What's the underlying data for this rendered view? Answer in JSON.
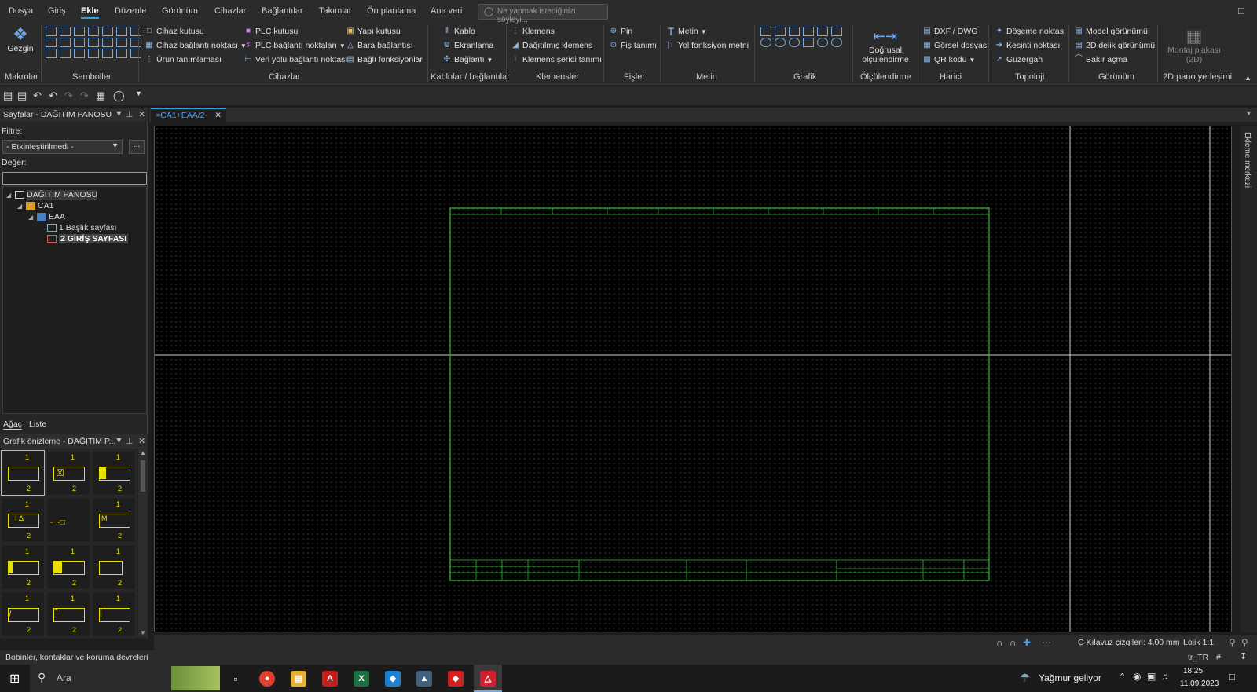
{
  "menu": {
    "items": [
      "Dosya",
      "Giriş",
      "Ekle",
      "Düzenle",
      "Görünüm",
      "Cihazlar",
      "Bağlantılar",
      "Takımlar",
      "Ön planlama",
      "Ana veri"
    ],
    "active": "Ekle",
    "search_placeholder": "Ne yapmak istediğinizi söyleyi..."
  },
  "ribbon": {
    "makrolar": {
      "label": "Makrolar",
      "gezgin": "Gezgin"
    },
    "semboller": {
      "label": "Semboller"
    },
    "cihazlar": {
      "label": "Cihazlar",
      "items": [
        "Cihaz kutusu",
        "Cihaz bağlantı noktası",
        "Ürün tanımlaması",
        "PLC kutusu",
        "PLC bağlantı noktaları",
        "Veri yolu bağlantı noktası",
        "Yapı kutusu",
        "Bara bağlantısı",
        "Bağlı fonksiyonlar"
      ]
    },
    "kablolar": {
      "label": "Kablolar / bağlantılar",
      "items": [
        "Kablo",
        "Ekranlama",
        "Bağlantı"
      ]
    },
    "klemensler": {
      "label": "Klemensler",
      "items": [
        "Klemens",
        "Dağıtılmış klemens",
        "Klemens şeridi tanımı"
      ]
    },
    "fisler": {
      "label": "Fişler",
      "items": [
        "Pin",
        "Fiş tanımı"
      ]
    },
    "metin": {
      "label": "Metin",
      "items": [
        "Metin",
        "Yol fonksiyon metni"
      ]
    },
    "grafik": {
      "label": "Grafik"
    },
    "olculendirme": {
      "label": "Ölçülendirme",
      "button": "Doğrusal ölçülendirme"
    },
    "harici": {
      "label": "Harici",
      "items": [
        "DXF / DWG",
        "Görsel dosyası",
        "QR kodu"
      ]
    },
    "topoloji": {
      "label": "Topoloji",
      "items": [
        "Döşeme noktası",
        "Kesinti noktası",
        "Güzergah"
      ]
    },
    "gorunum": {
      "label": "Görünüm",
      "items": [
        "Model görünümü",
        "2D delik görünümü",
        "Bakır açma"
      ]
    },
    "pano": {
      "label": "2D pano yerleşimi",
      "button": "Montaj plakası (2D)"
    }
  },
  "pages_panel": {
    "title": "Sayfalar - DAĞITIM PANOSU",
    "filter_label": "Filtre:",
    "filter_value": "- Etkinleştirilmedi -",
    "value_label": "Değer:",
    "tree": [
      "DAĞITIM PANOSU",
      "CA1",
      "EAA",
      "1 Başlık sayfası",
      "2 GİRİŞ SAYFASI"
    ],
    "tabs": [
      "Ağaç",
      "Liste"
    ]
  },
  "preview_panel": {
    "title": "Grafik önizleme - DAĞITIM P..."
  },
  "document": {
    "tab": "=CA1+EAA/2",
    "side_tab": "Ekleme merkezi"
  },
  "canvas_status": {
    "grid": "C Kılavuz çizgileri: 4,00 mm",
    "logic": "Lojik 1:1"
  },
  "status_bar": {
    "message": "Bobinler, kontaklar ve koruma devreleri",
    "locale": "tr_TR",
    "hash": "#"
  },
  "taskbar": {
    "search": "Ara",
    "weather": "Yağmur geliyor",
    "time": "18:25",
    "date": "11.09.2023"
  },
  "colors": {
    "accent": "#3a9ee0",
    "symbol": "#e8e000",
    "frame": "#2fbf2f"
  }
}
